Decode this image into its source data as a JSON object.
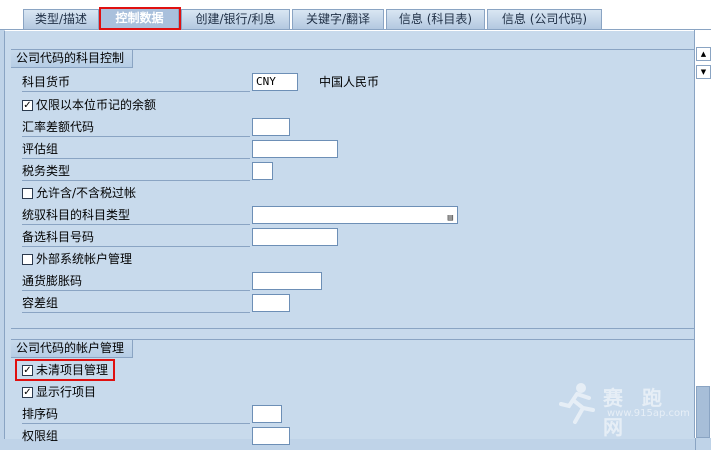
{
  "tabs": [
    {
      "label": "类型/描述"
    },
    {
      "label": "控制数据"
    },
    {
      "label": "创建/银行/利息"
    },
    {
      "label": "关键字/翻译"
    },
    {
      "label": "信息 (科目表)"
    },
    {
      "label": "信息 (公司代码)"
    }
  ],
  "group1": {
    "title": "公司代码的科目控制",
    "account_currency_label": "科目货币",
    "account_currency_value": "CNY",
    "account_currency_desc": "中国人民币",
    "only_local_balance_label": "仅限以本位币记的余额",
    "only_local_balance_checked": true,
    "exchange_diff_label": "汇率差额代码",
    "exchange_diff_value": "",
    "valuation_group_label": "评估组",
    "valuation_group_value": "",
    "tax_category_label": "税务类型",
    "tax_category_value": "",
    "posting_without_tax_label": "允许含/不含税过帐",
    "posting_without_tax_checked": false,
    "recon_account_type_label": "统驭科目的科目类型",
    "recon_account_type_value": "",
    "alt_account_label": "备选科目号码",
    "alt_account_value": "",
    "ext_system_label": "外部系统帐户管理",
    "ext_system_checked": false,
    "inflation_key_label": "通货膨胀码",
    "inflation_key_value": "",
    "tolerance_group_label": "容差组",
    "tolerance_group_value": ""
  },
  "group2": {
    "title": "公司代码的帐户管理",
    "open_item_label": "未清项目管理",
    "open_item_checked": true,
    "line_items_label": "显示行项目",
    "line_items_checked": true,
    "sort_key_label": "排序码",
    "sort_key_value": "",
    "auth_group_label": "权限组",
    "auth_group_value": ""
  },
  "watermark": {
    "brand": "赛 跑 网",
    "url": "www.915ap.com"
  },
  "icons": {
    "scroll_up": "scroll-up-icon",
    "scroll_down": "scroll-down-icon",
    "help": "f4-help-icon",
    "watermark": "runner-logo-icon"
  },
  "colors": {
    "highlight": "#e01010",
    "panel": "#c8daec",
    "border": "#8aa4c3"
  }
}
